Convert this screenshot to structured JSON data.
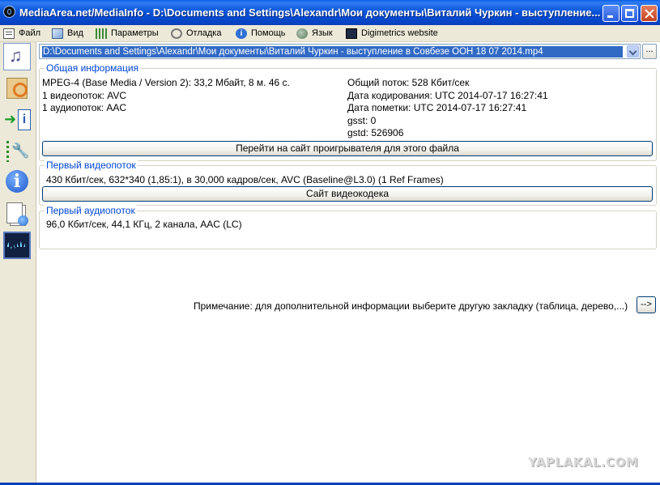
{
  "window": {
    "title": "MediaArea.net/MediaInfo - D:\\Documents and Settings\\Alexandr\\Мои документы\\Виталий Чуркин - выступление..."
  },
  "menu": {
    "items": [
      {
        "label": "Файл",
        "icon": "file-icon"
      },
      {
        "label": "Вид",
        "icon": "view-icon"
      },
      {
        "label": "Параметры",
        "icon": "params-icon"
      },
      {
        "label": "Отладка",
        "icon": "debug-icon"
      },
      {
        "label": "Помощь",
        "icon": "help-icon"
      },
      {
        "label": "Язык",
        "icon": "language-icon"
      },
      {
        "label": "Digimetrics website",
        "icon": "digimetrics-icon"
      }
    ]
  },
  "file_selector": {
    "path": "D:\\Documents and Settings\\Alexandr\\Мои документы\\Виталий Чуркин - выступление в Совбезе ООН 18 07 2014.mp4",
    "browse_label": "..."
  },
  "general": {
    "title": "Общая информация",
    "left": [
      "MPEG-4 (Base Media / Version 2): 33,2 Мбайт, 8 м. 46 с.",
      "1 видеопоток: AVC",
      "1 аудиопоток: AAC"
    ],
    "right": [
      "Общий поток: 528 Кбит/сек",
      "Дата кодирования: UTC 2014-07-17 16:27:41",
      "Дата пометки: UTC 2014-07-17 16:27:41",
      "gsst: 0",
      "gstd: 526906"
    ],
    "button": "Перейти на сайт проигрывателя для этого файла"
  },
  "video": {
    "title": "Первый видеопоток",
    "info": "430 Кбит/сек, 632*340 (1,85:1), в 30,000 кадров/сек, AVC (Baseline@L3.0) (1 Ref Frames)",
    "button": "Сайт видеокодека"
  },
  "audio": {
    "title": "Первый аудиопоток",
    "info": "96,0 Кбит/сек, 44,1 КГц, 2 канала, AAC (LC)"
  },
  "note": {
    "text": "Примечание: для дополнительной информации выберите другую закладку (таблица, дерево,...)",
    "button": "-->"
  },
  "watermark": "YAPLAKAL.COM"
}
